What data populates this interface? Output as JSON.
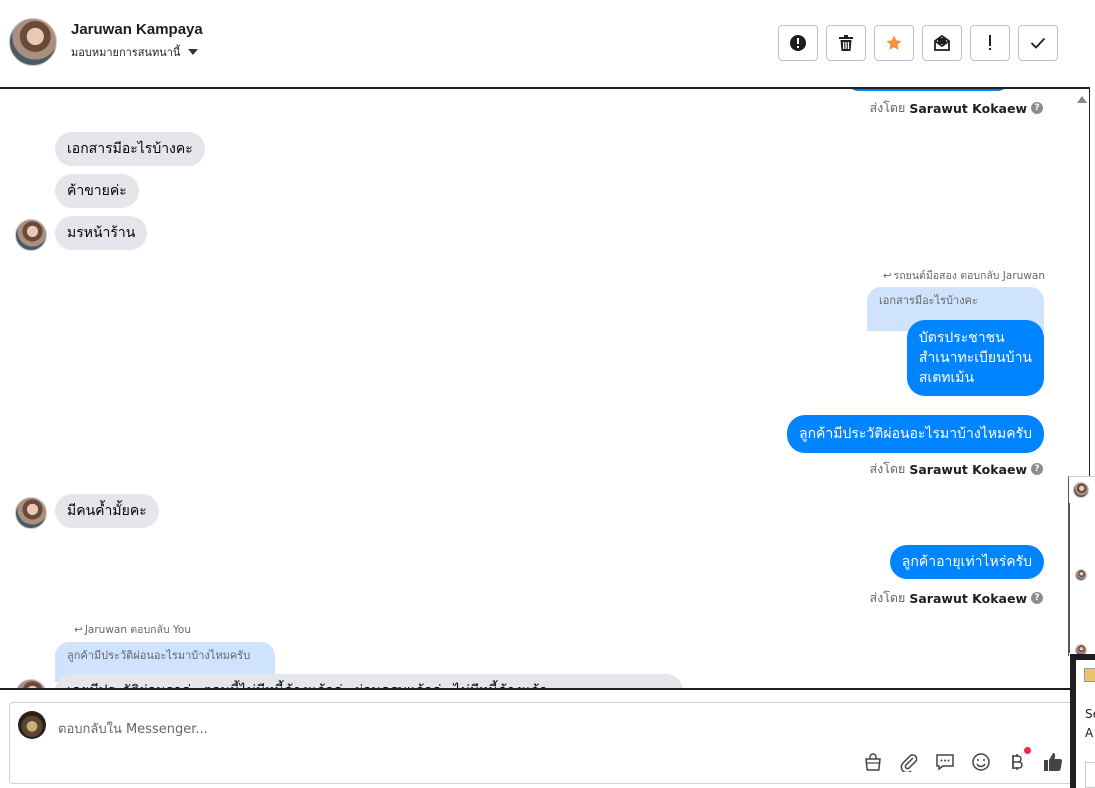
{
  "header": {
    "contact_name": "Jaruwan Kampaya",
    "assign_label": "มอบหมายการสนทนานี้",
    "toolbar": [
      {
        "name": "mark-spam-button",
        "icon": "alert-circle-icon"
      },
      {
        "name": "delete-button",
        "icon": "trash-icon"
      },
      {
        "name": "star-button",
        "icon": "star-icon"
      },
      {
        "name": "mark-unread-button",
        "icon": "envelope-icon"
      },
      {
        "name": "mark-important-button",
        "icon": "exclamation-icon"
      },
      {
        "name": "mark-done-button",
        "icon": "check-icon"
      }
    ]
  },
  "conversation": {
    "sent_by_prefix": "ส่งโดย",
    "sent_by_name": "Sarawut Kokaew",
    "incoming_1": [
      "เอกสารมีอะไรบ้างคะ",
      "ค้าขายค่ะ",
      "มรหน้าร้าน"
    ],
    "reply_line_1": "รถยนต์มือสอง ตอบกลับ Jaruwan",
    "quote_1": "เอกสารมีอะไรบ้างคะ",
    "outgoing_1_lines": [
      "บัตรประชาชน",
      "สำเนาทะเบียนบ้าน",
      "สเตทเม้น"
    ],
    "outgoing_2": "ลูกค้ามีประวัติผ่อนอะไรมาบ้างไหมครับ",
    "incoming_2": "มีคนค้ำมั้ยคะ",
    "outgoing_3": "ลูกค้าอายุเท่าไหร่ครับ",
    "reply_line_2": "Jaruwan ตอบกลับ You",
    "quote_2": "ลูกค้ามีประวัติผ่อนอะไรมาบ้างไหมครับ",
    "incoming_3_partial": "เคยมีประวัติผ่อนรถค่ะ ตอนนี้ไม่มีหนี้ค้างแล้วค่ะ ผ่อนครบแล้วค่ะ ไม่มีหนี้ค้างแล้ว"
  },
  "composer": {
    "placeholder": "ตอบกลับใน Messenger...",
    "icons": [
      "shopping-bag-icon",
      "paperclip-icon",
      "saved-reply-icon",
      "emoji-icon",
      "baht-payment-icon",
      "thumbs-up-icon"
    ]
  },
  "side": {
    "text_1": "Se",
    "text_2": "A"
  },
  "colors": {
    "outgoing_bubble": "#0084ff",
    "incoming_bubble": "#e4e6eb",
    "quote_bubble": "#cfe3fd",
    "star": "#f7923a",
    "notification_dot": "#f02849"
  }
}
